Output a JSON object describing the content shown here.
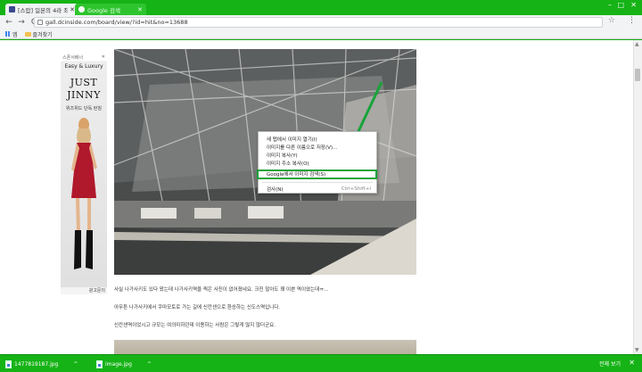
{
  "browser": {
    "tabs": [
      {
        "title": "[스압] 일본의 4라 최악의 미...",
        "active": true
      },
      {
        "title": "Google 검색",
        "active": false
      }
    ],
    "url": "gall.dcinside.com/board/view/?id=hit&no=13688",
    "nav": {
      "back": "←",
      "forward": "→",
      "reload": "C"
    },
    "window_controls": {
      "minimize": "–",
      "maximize": "□",
      "close": "✕"
    },
    "bookmarks": {
      "apps_label": "앱",
      "folder_label": "즐겨찾기"
    },
    "theme_color": "#16b316"
  },
  "ad": {
    "header_label": "스폰서배너",
    "line1": "Easy & Luxury",
    "line2": "JUST",
    "line3": "JINNY",
    "line4": "위즈위드 단독 런칭",
    "footer": "광고문의"
  },
  "context_menu": {
    "items": [
      {
        "label": "새 탭에서 이미지 열기(I)",
        "shortcut": ""
      },
      {
        "label": "이미지를 다른 이름으로 저장(V)...",
        "shortcut": ""
      },
      {
        "label": "이미지 복사(Y)",
        "shortcut": ""
      },
      {
        "label": "이미지 주소 복사(O)",
        "shortcut": ""
      },
      {
        "label": "Google에서 이미지 검색(S)",
        "shortcut": "",
        "highlighted": true
      },
      {
        "label": "검사(N)",
        "shortcut": "Ctrl+Shift+I"
      }
    ],
    "highlight_color": "#17a33a"
  },
  "article": {
    "paragraphs": [
      "사실 나가사키도 있다 왔는데 나가사키역을 찍은 사진이 없어졌네요. 크진 않아도 꽤 이쁜 역이였는데ㅠ...",
      "아무튼 나가사키에서 쿠마모토로 가는 길에 신칸센으로 환승하는 신도스역입니다.",
      "신칸센역이었시고 규모는 여의미하던데 이용하는 사람은 그렇게 많지 않더군요."
    ]
  },
  "downloads": {
    "files": [
      {
        "name": "1477819187.jpg"
      },
      {
        "name": "image.jpg"
      }
    ],
    "show_all": "전체 보기",
    "close": "✕"
  }
}
